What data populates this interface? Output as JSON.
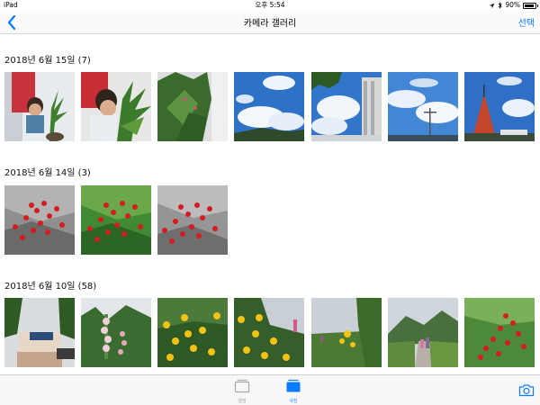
{
  "status_bar": {
    "device": "iPad",
    "time": "오후 5:54",
    "battery": "90%",
    "battery_level": 0.9
  },
  "nav": {
    "title": "카메라 갤러리",
    "select_label": "선택"
  },
  "sections": [
    {
      "header": "2018년 6월 15일 (7)"
    },
    {
      "header": "2018년 6월 14일 (3)"
    },
    {
      "header": "2018년 6월 10일 (58)"
    }
  ],
  "tabs": {
    "albums": "앨범",
    "photos": "사진"
  },
  "colors": {
    "accent": "#0a7aff",
    "inactive_tab": "#a8a8ad"
  }
}
